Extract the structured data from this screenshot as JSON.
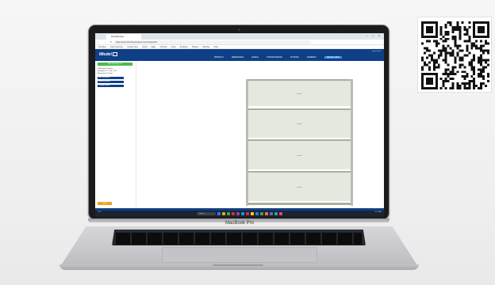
{
  "browser": {
    "tab_title": "PartsDesign",
    "tab_close": "×",
    "window_controls": "— ▢ ✕",
    "nav_glyphs": "← → ⟳",
    "url": "https://www.shelving-designer.com/configurator",
    "bookmarks": [
      "Favorites",
      "Import favorites",
      "Google Docs",
      "Gmail",
      "Maps",
      "YouTube",
      "News",
      "Shopping",
      "Projects",
      "Weather",
      "Other"
    ]
  },
  "app": {
    "logo_text": "iModel",
    "header_tiny": "my account",
    "nav": [
      {
        "label": "PRODUCT",
        "active": false
      },
      {
        "label": "DIMENSIONS",
        "active": false
      },
      {
        "label": "LEVELS",
        "active": false
      },
      {
        "label": "CONFIGURATION",
        "active": false
      },
      {
        "label": "OPTIONS",
        "active": false
      },
      {
        "label": "SUMMARY",
        "active": false
      },
      {
        "label": "DESIGN VIEW",
        "active": true
      }
    ]
  },
  "sidebar": {
    "green_button": "Add Shelving Unit",
    "labels": [
      "Information Options",
      "Standard: 72\" x 36\" x 18\"",
      "Beam Qty: 4 Levels"
    ],
    "buttons": [
      "Add Component",
      "Add Accessories",
      "Change Options"
    ],
    "orange_button": "Back"
  },
  "shelf": {
    "bay_labels": [
      "Level 4",
      "Level 3",
      "Level 2",
      "Level 1"
    ],
    "bay_fractions": [
      0.22,
      0.24,
      0.24,
      0.24
    ]
  },
  "footer": {
    "text": "© Shelving Designer"
  },
  "taskbar": {
    "weather": "72°F",
    "weather_sub": "Sunny",
    "search_placeholder": "Search",
    "clock": "10:24 AM",
    "icon_colors": [
      "#2b7de9",
      "#f0a21e",
      "#3aa757",
      "#d93025",
      "#8e44ad",
      "#0aa0d6",
      "#e91e63",
      "#ffd600",
      "#2b7de9",
      "#3aa757",
      "#ff7043",
      "#5c6bc0",
      "#26a69a",
      "#ec407a"
    ]
  },
  "laptop": {
    "brand": "MacBook Pro"
  }
}
